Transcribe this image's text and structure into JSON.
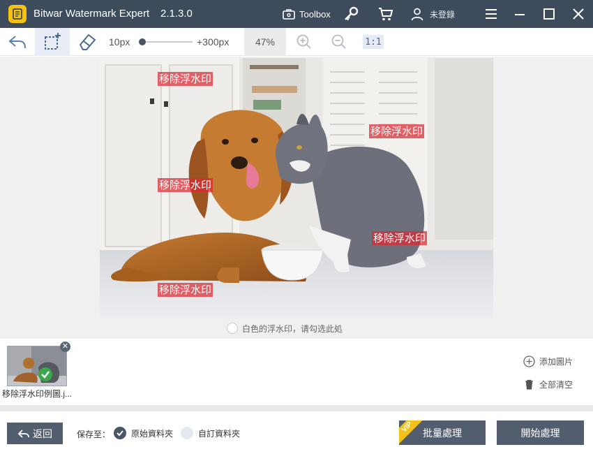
{
  "app": {
    "title": "Bitwar Watermark Expert",
    "version": "2.1.3.0",
    "toolbox_label": "Toolbox",
    "user_label": "未登錄"
  },
  "toolbar": {
    "brush_min": "10px",
    "brush_max": "+300px",
    "brush_size_fraction": 0.0,
    "zoom_level": "47%",
    "actual_size_label": "1:1"
  },
  "canvas": {
    "watermarks": [
      {
        "text": "移除浮水印"
      },
      {
        "text": "移除浮水印"
      },
      {
        "text": "移除浮水印"
      },
      {
        "text": "移除浮水印"
      },
      {
        "text": "移除浮水印"
      }
    ],
    "white_watermark_label": "白色的浮水印，请勾选此処"
  },
  "thumbnails": {
    "items": [
      {
        "name": "移除浮水印例圖.j..."
      }
    ]
  },
  "side_actions": {
    "add_image": "添加圖片",
    "clear_all": "全部清空"
  },
  "bottom": {
    "back_label": "返回",
    "save_to_label": "保存至：",
    "options": [
      {
        "label": "原始資料夾",
        "selected": true
      },
      {
        "label": "自訂資料夾",
        "selected": false
      }
    ],
    "vip_label": "VIP",
    "batch_label": "批量處理",
    "start_label": "開始處理"
  },
  "colors": {
    "titlebar": "#3e4b5c",
    "button": "#525e6e",
    "watermark_fill": "#dc2832",
    "logo": "#f6c20f",
    "check": "#3aa84b"
  }
}
